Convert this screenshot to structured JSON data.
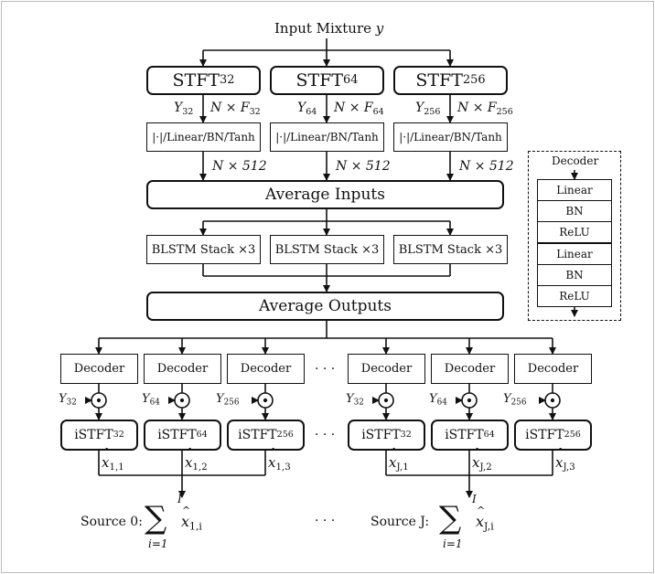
{
  "input": {
    "label": "Input Mixture ",
    "var": "y"
  },
  "stft": [
    {
      "main": "STFT",
      "sub": "32",
      "y": "Y",
      "ysub": "32",
      "dim": "N × F",
      "dimsub": "32"
    },
    {
      "main": "STFT",
      "sub": "64",
      "y": "Y",
      "ysub": "64",
      "dim": "N × F",
      "dimsub": "64"
    },
    {
      "main": "STFT",
      "sub": "256",
      "y": "Y",
      "ysub": "256",
      "dim": "N × F",
      "dimsub": "256"
    }
  ],
  "preproc_label": "|·|/Linear/BN/Tanh",
  "embed_dim": "N × 512",
  "average_inputs": "Average Inputs",
  "blstm_label": "BLSTM Stack ×3",
  "average_outputs": "Average Outputs",
  "decoder_label": "Decoder",
  "ellipsis": "· · ·",
  "branches": [
    {
      "y": "Y",
      "ysub": "32",
      "istft": "iSTFT",
      "isub": "32",
      "xhat": "x",
      "xsub": "1,1"
    },
    {
      "y": "Y",
      "ysub": "64",
      "istft": "iSTFT",
      "isub": "64",
      "xhat": "x",
      "xsub": "1,2"
    },
    {
      "y": "Y",
      "ysub": "256",
      "istft": "iSTFT",
      "isub": "256",
      "xhat": "x",
      "xsub": "1,3"
    },
    {
      "y": "Y",
      "ysub": "32",
      "istft": "iSTFT",
      "isub": "32",
      "xhat": "x",
      "xsub": "J,1"
    },
    {
      "y": "Y",
      "ysub": "64",
      "istft": "iSTFT",
      "isub": "64",
      "xhat": "x",
      "xsub": "J,2"
    },
    {
      "y": "Y",
      "ysub": "256",
      "istft": "iSTFT",
      "isub": "256",
      "xhat": "x",
      "xsub": "J,3"
    }
  ],
  "sources": [
    {
      "label": "Source 0:",
      "upper": "I",
      "lower": "i=1",
      "sigma": "∑",
      "term": "x",
      "termsub": "1,i"
    },
    {
      "label": "Source J:",
      "upper": "I",
      "lower": "i=1",
      "sigma": "∑",
      "term": "x",
      "termsub": "J,i"
    }
  ],
  "decoder_detail": {
    "title": "Decoder",
    "layers": [
      "Linear",
      "BN",
      "ReLU",
      "Linear",
      "BN",
      "ReLU"
    ]
  }
}
